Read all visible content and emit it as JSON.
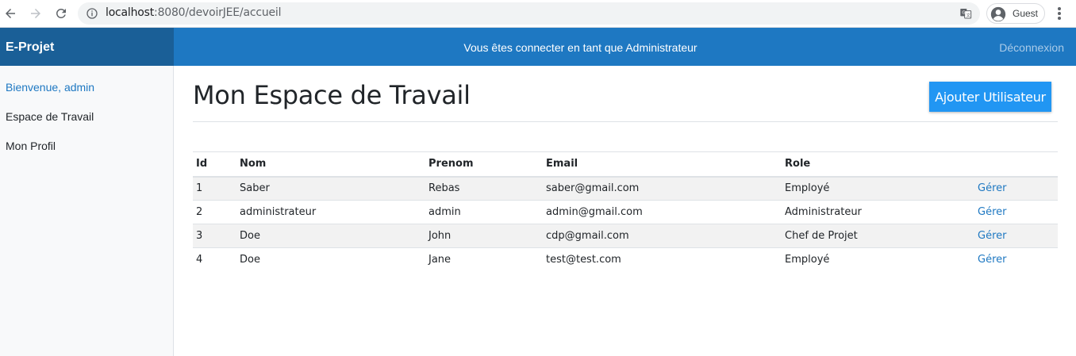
{
  "browser": {
    "url_host": "localhost",
    "url_path": ":8080/devoirJEE/accueil",
    "profile_label": "Guest"
  },
  "navbar": {
    "brand": "E-Projet",
    "status": "Vous êtes connecter en tant que Administrateur",
    "logout": "Déconnexion"
  },
  "sidebar": {
    "items": [
      {
        "label": "Bienvenue, admin"
      },
      {
        "label": "Espace de Travail"
      },
      {
        "label": "Mon Profil"
      }
    ]
  },
  "main": {
    "title": "Mon Espace de Travail",
    "add_button": "Ajouter Utilisateur"
  },
  "table": {
    "headers": [
      "Id",
      "Nom",
      "Prenom",
      "Email",
      "Role",
      ""
    ],
    "rows": [
      {
        "id": "1",
        "nom": "Saber",
        "prenom": "Rebas",
        "email": "saber@gmail.com",
        "role": "Employé",
        "action": "Gérer"
      },
      {
        "id": "2",
        "nom": "administrateur",
        "prenom": "admin",
        "email": "admin@gmail.com",
        "role": "Administrateur",
        "action": "Gérer"
      },
      {
        "id": "3",
        "nom": "Doe",
        "prenom": "John",
        "email": "cdp@gmail.com",
        "role": "Chef de Projet",
        "action": "Gérer"
      },
      {
        "id": "4",
        "nom": "Doe",
        "prenom": "Jane",
        "email": "test@test.com",
        "role": "Employé",
        "action": "Gérer"
      }
    ]
  },
  "colors": {
    "navbar": "#1e78c2",
    "brand_bg": "#1a5f97",
    "accent": "#2196f3",
    "link": "#1e78c2"
  },
  "icons": [
    "back-arrow-icon",
    "forward-arrow-icon",
    "reload-icon",
    "info-icon",
    "translate-icon",
    "avatar-icon",
    "menu-dots-icon"
  ]
}
